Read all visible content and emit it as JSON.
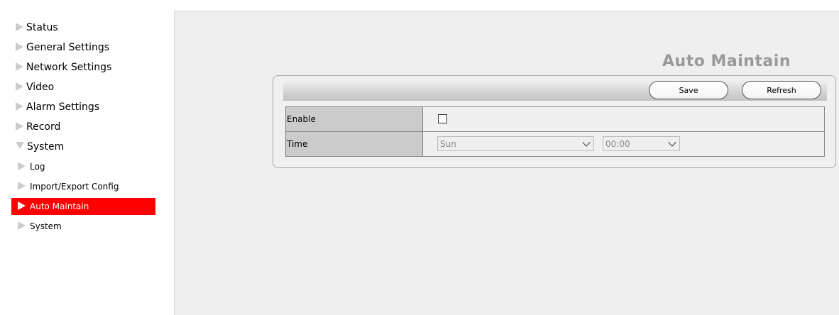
{
  "sidebar": {
    "items": [
      {
        "label": "Status"
      },
      {
        "label": "General Settings"
      },
      {
        "label": "Network Settings"
      },
      {
        "label": "Video"
      },
      {
        "label": "Alarm Settings"
      },
      {
        "label": "Record"
      },
      {
        "label": "System",
        "expanded": true
      }
    ],
    "sub_items": [
      {
        "label": "Log"
      },
      {
        "label": "Import/Export Config"
      },
      {
        "label": "Auto Maintain",
        "active": true
      },
      {
        "label": "System"
      }
    ],
    "active_color": "#ff0000"
  },
  "main": {
    "title": "Auto Maintain",
    "toolbar": {
      "save_label": "Save",
      "refresh_label": "Refresh"
    },
    "rows": [
      {
        "label": "Enable",
        "checked": false
      },
      {
        "label": "Time",
        "day": "Sun",
        "time": "00:00"
      }
    ]
  }
}
